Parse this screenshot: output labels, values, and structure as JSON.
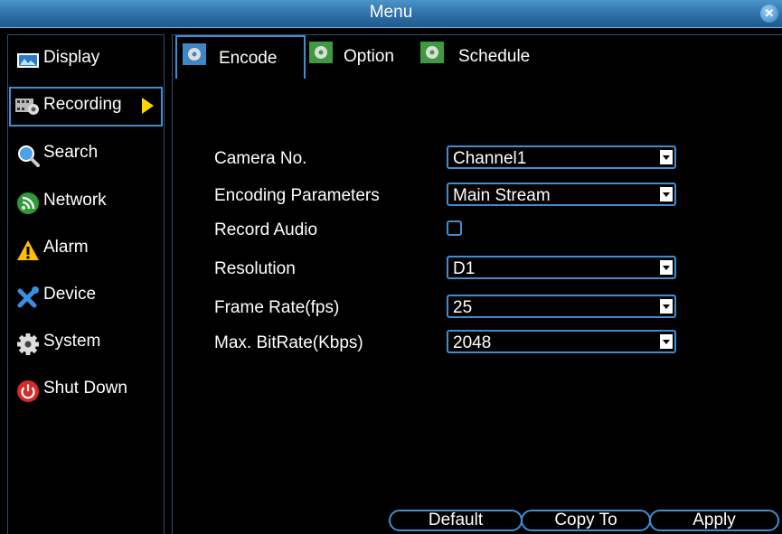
{
  "window": {
    "title": "Menu"
  },
  "sidebar": {
    "items": [
      {
        "label": "Display",
        "icon": "display-icon"
      },
      {
        "label": "Recording",
        "icon": "recording-icon",
        "active": true
      },
      {
        "label": "Search",
        "icon": "search-icon"
      },
      {
        "label": "Network",
        "icon": "network-icon"
      },
      {
        "label": "Alarm",
        "icon": "alarm-icon"
      },
      {
        "label": "Device",
        "icon": "device-icon"
      },
      {
        "label": "System",
        "icon": "system-gear-icon"
      },
      {
        "label": "Shut Down",
        "icon": "power-icon"
      }
    ]
  },
  "tabs": [
    {
      "label": "Encode",
      "active": true
    },
    {
      "label": "Option"
    },
    {
      "label": "Schedule"
    }
  ],
  "form": {
    "camera_no": {
      "label": "Camera No.",
      "value": "Channel1"
    },
    "encoding_parameters": {
      "label": "Encoding Parameters",
      "value": "Main Stream"
    },
    "record_audio": {
      "label": "Record Audio",
      "checked": false
    },
    "resolution": {
      "label": "Resolution",
      "value": "D1"
    },
    "frame_rate": {
      "label": "Frame Rate(fps)",
      "value": "25"
    },
    "max_bitrate": {
      "label": "Max. BitRate(Kbps)",
      "value": "2048"
    }
  },
  "buttons": {
    "default": "Default",
    "copy_to": "Copy To",
    "apply": "Apply"
  },
  "colors": {
    "accent": "#3e8ed0",
    "titlebar": "#2d6fa6",
    "arrow": "#ffd500",
    "background": "#000000"
  }
}
